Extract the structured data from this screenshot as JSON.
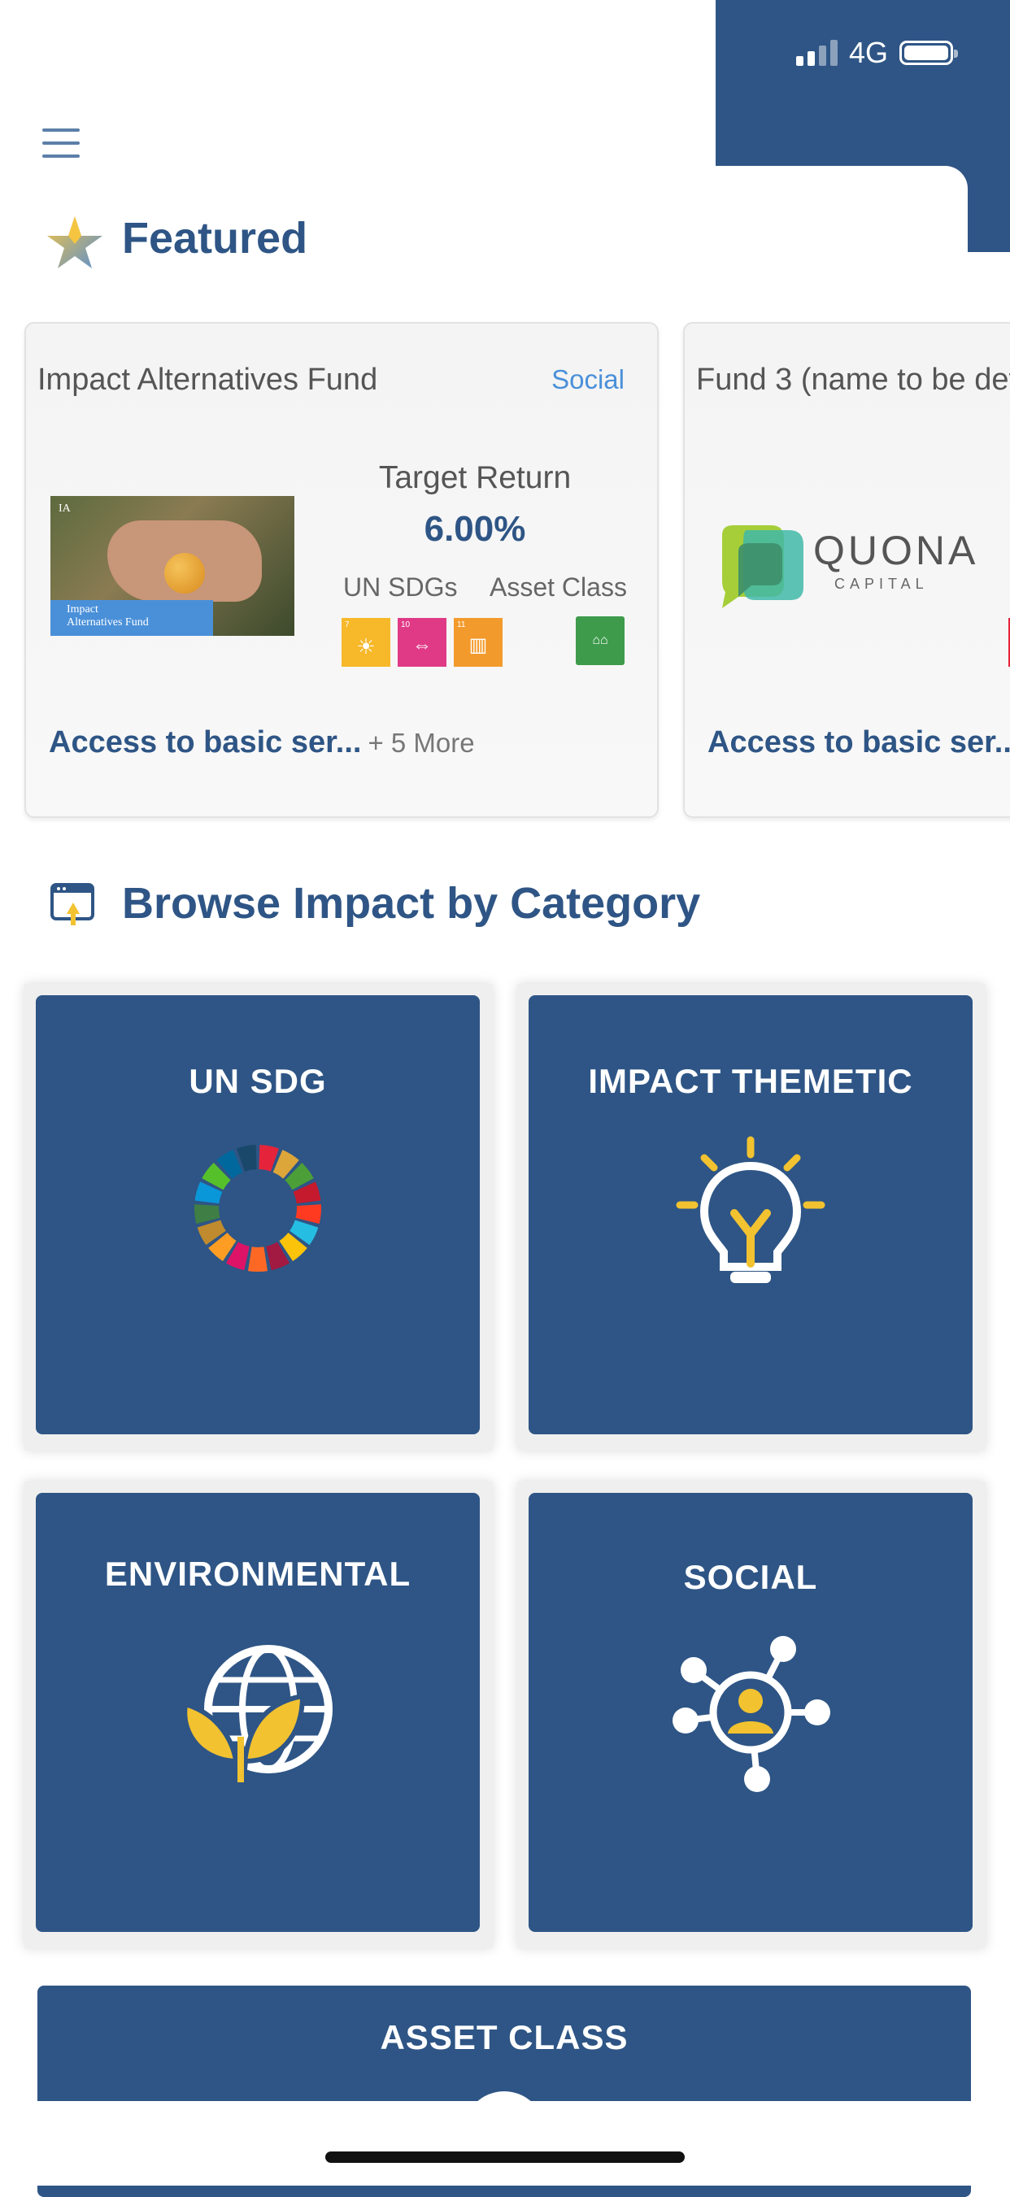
{
  "status_bar": {
    "network": "4G",
    "signal_bars": 2
  },
  "featured": {
    "title": "Featured",
    "cards": [
      {
        "name": "Impact Alternatives Fund",
        "tag": "Social",
        "image_caption": "Impact\nAlternatives Fund",
        "target_return_label": "Target Return",
        "target_return_value": "6.00%",
        "sdgs_label": "UN SDGs",
        "asset_class_label": "Asset Class",
        "access": "Access to basic ser...",
        "more": "+ 5 More"
      },
      {
        "name": "Fund 3 (name to be det",
        "logo_name": "QUONA",
        "logo_sub": "CAPITAL",
        "access": "Access to basic ser...",
        "more": "+"
      }
    ]
  },
  "browse": {
    "title": "Browse Impact by Category",
    "categories": [
      {
        "label": "UN SDG",
        "icon": "sdg-wheel-icon"
      },
      {
        "label": "IMPACT THEMETIC",
        "icon": "lightbulb-icon"
      },
      {
        "label": "ENVIRONMENTAL",
        "icon": "leaf-globe-icon"
      },
      {
        "label": "SOCIAL",
        "icon": "network-person-icon"
      },
      {
        "label": "ASSET CLASS",
        "icon": "asset-class-icon"
      }
    ]
  },
  "colors": {
    "primary": "#2e5585",
    "accent_blue": "#4a90d9",
    "yellow": "#f2c230",
    "sdg7": "#f7b82a",
    "sdg10": "#e03a86",
    "sdg11": "#f39a2c",
    "asset_green": "#3e9b4c"
  }
}
